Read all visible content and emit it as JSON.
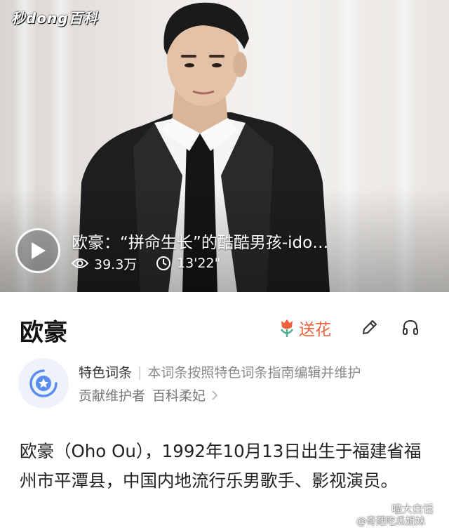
{
  "video": {
    "logo": "秒dong百科",
    "title": "欧豪：“拼命生长”的酷酷男孩-ido…",
    "views": "39.3万",
    "duration": "13'22\""
  },
  "entry": {
    "title": "欧豪",
    "flower_label": "送花"
  },
  "feature": {
    "tag": "特色词条",
    "description": "本词条按照特色词条指南编辑并维护",
    "contributor_label": "贡献维护者",
    "contributor_name": "百科柔妃"
  },
  "summary": "欧豪（Oho Ou），1992年10月13日出生于福建省福州市平潭县，中国内地流行乐男歌手、影视演员。",
  "watermark": {
    "top": "喵大白话",
    "bottom": "@奇葩吃瓜姐妹"
  },
  "colors": {
    "accent": "#f0623b",
    "badge_bg": "#eef3fb",
    "badge_icon": "#5b8def"
  },
  "icons": [
    "play-icon",
    "eye-icon",
    "clock-icon",
    "flower-icon",
    "pencil-icon",
    "headphones-icon",
    "star-badge-icon",
    "chevron-right-icon",
    "wechat-icon"
  ]
}
